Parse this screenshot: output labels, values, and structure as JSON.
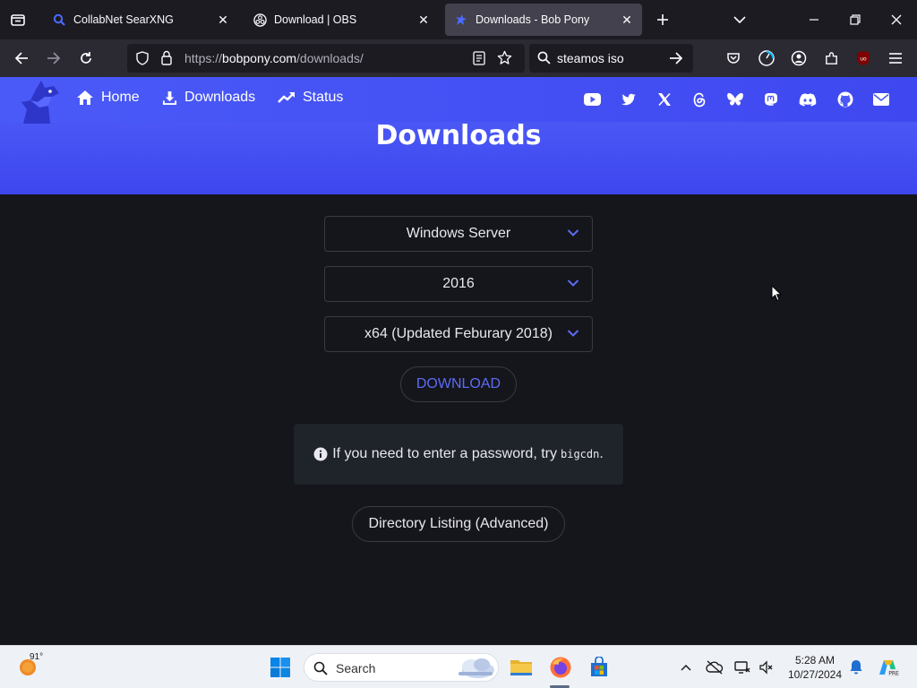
{
  "browser": {
    "tabs": [
      {
        "title": "CollabNet SearXNG",
        "icon": "search-magnifier-icon",
        "active": false
      },
      {
        "title": "Download | OBS",
        "icon": "obs-icon",
        "active": false
      },
      {
        "title": "Downloads - Bob Pony",
        "icon": "bobpony-icon",
        "active": true
      }
    ],
    "url_prefix": "https://",
    "url_domain": "bobpony.com",
    "url_path": "/downloads/",
    "search_value": "steamos iso"
  },
  "site": {
    "nav": [
      {
        "label": "Home",
        "icon": "home-icon"
      },
      {
        "label": "Downloads",
        "icon": "download-icon"
      },
      {
        "label": "Status",
        "icon": "trending-icon"
      }
    ],
    "social_icons": [
      "youtube-icon",
      "twitter-icon",
      "x-icon",
      "threads-icon",
      "bluesky-icon",
      "mastodon-icon",
      "discord-icon",
      "github-icon",
      "mail-icon"
    ],
    "title": "Downloads"
  },
  "form": {
    "os_select": "Windows Server",
    "version_select": "2016",
    "edition_select": "x64 (Updated Feburary 2018)",
    "download_label": "DOWNLOAD",
    "notice_text": "If you need to enter a password, try",
    "notice_code": "bigcdn",
    "notice_end": ".",
    "dirlist_label": "Directory Listing (Advanced)"
  },
  "taskbar": {
    "weather_temp": "91°",
    "search_placeholder": "Search",
    "time": "5:28 AM",
    "date": "10/27/2024"
  },
  "colors": {
    "accent": "#4f5cf7",
    "link": "#5c6cf5",
    "page_bg": "#15151c"
  }
}
